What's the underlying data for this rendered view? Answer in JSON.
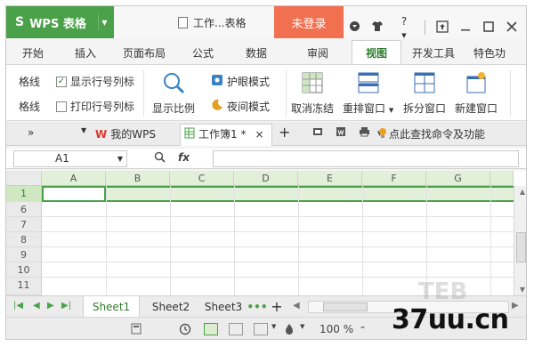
{
  "titlebar": {
    "app_button": "WPS 表格",
    "document_title": "工作...表格",
    "login_label": "未登录",
    "icons": [
      "skin-icon",
      "shirt-icon",
      "help-icon",
      "upload-icon",
      "minimize-icon",
      "maximize-icon",
      "close-icon"
    ],
    "help_label": "?"
  },
  "ribbon_tabs": [
    {
      "label": "开始"
    },
    {
      "label": "插入"
    },
    {
      "label": "页面布局"
    },
    {
      "label": "公式"
    },
    {
      "label": "数据"
    },
    {
      "label": "审阅"
    },
    {
      "label": "视图",
      "active": true
    },
    {
      "label": "开发工具"
    },
    {
      "label": "特色功"
    }
  ],
  "ribbon": {
    "gridlines_label": "网格线",
    "gridlines_label_cut": "格线",
    "show_rowcol_label": "显示行号列标",
    "show_rowcol_checked": true,
    "print_gridlines_cut": "格线",
    "print_rowcol_label": "打印行号列标",
    "print_rowcol_checked": false,
    "zoom_label": "显示比例",
    "eye_mode_label": "护眼模式",
    "night_mode_label": "夜间模式",
    "unfreeze_label": "取消冻结",
    "rearrange_label": "重排窗口",
    "split_label": "拆分窗口",
    "new_window_label": "新建窗口"
  },
  "doc_tabs": {
    "expand": "»",
    "my_wps": "我的WPS",
    "workbook": "工作簿1 *",
    "close_glyph": "×",
    "add_glyph": "+",
    "search_hint": "点此查找命令及功能"
  },
  "formula_bar": {
    "cell_ref": "A1",
    "fx": "fx",
    "formula": ""
  },
  "grid": {
    "columns": [
      "A",
      "B",
      "C",
      "D",
      "E",
      "F",
      "G"
    ],
    "rows": [
      "1",
      "6",
      "7",
      "8",
      "9",
      "10",
      "11"
    ],
    "selected_row": "1",
    "active_cell": "A1"
  },
  "sheets": {
    "tabs": [
      "Sheet1",
      "Sheet2",
      "Sheet3"
    ],
    "active": "Sheet1",
    "more_glyph": "•••",
    "add_glyph": "+"
  },
  "statusbar": {
    "zoom_value": "100 %",
    "zoom_minus": "-"
  },
  "watermark": {
    "text": "37uu.cn",
    "ghost": "TEB"
  },
  "colors": {
    "accent_green": "#4aa14a",
    "login_orange": "#f07050",
    "selection_fill": "#e2f0d9"
  }
}
